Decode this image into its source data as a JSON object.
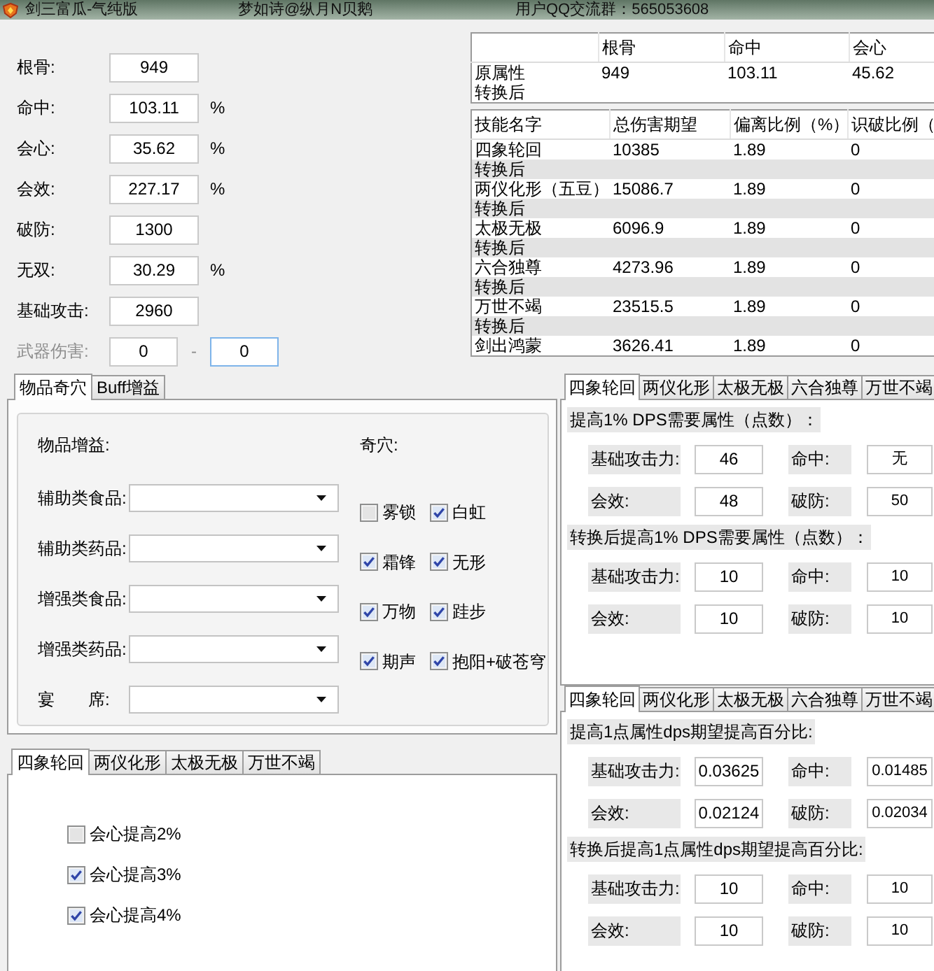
{
  "title_bar": {
    "app_title": "剑三富瓜-气纯版",
    "author": "梦如诗@纵月N贝鹅",
    "group_info": "用户QQ交流群：565053608"
  },
  "attributes": [
    {
      "label": "根骨:",
      "value": "949"
    },
    {
      "label": "命中:",
      "value": "103.11",
      "unit": "%"
    },
    {
      "label": "会心:",
      "value": "35.62",
      "unit": "%"
    },
    {
      "label": "会效:",
      "value": "227.17",
      "unit": "%"
    },
    {
      "label": "破防:",
      "value": "1300"
    },
    {
      "label": "无双:",
      "value": "30.29",
      "unit": "%"
    },
    {
      "label": "基础攻击:",
      "value": "2960"
    }
  ],
  "weapon_damage": {
    "label": "武器伤害:",
    "disabled": true,
    "separator": "-",
    "fields": [
      {
        "value": "0",
        "focused": false
      },
      {
        "value": "0",
        "focused": true
      }
    ]
  },
  "attribute_table": {
    "columns": [
      "根骨",
      "命中",
      "会心"
    ],
    "rows": [
      {
        "label": "原属性",
        "cells": [
          "949",
          "103.11",
          "45.62"
        ]
      },
      {
        "label": "转换后"
      }
    ]
  },
  "skill_table": {
    "columns": [
      "技能名字",
      "总伤害期望",
      "偏离比例（%）",
      "识破比例（"
    ],
    "rows": [
      {
        "kind": "skill",
        "cells": [
          "四象轮回",
          "10385",
          "1.89",
          "0"
        ]
      },
      {
        "kind": "converted",
        "cells": [
          "转换后"
        ]
      },
      {
        "kind": "skill",
        "cells": [
          "两仪化形（五豆）",
          "15086.7",
          "1.89",
          "0"
        ]
      },
      {
        "kind": "converted",
        "cells": [
          "转换后"
        ]
      },
      {
        "kind": "skill",
        "cells": [
          "太极无极",
          "6096.9",
          "1.89",
          "0"
        ]
      },
      {
        "kind": "converted",
        "cells": [
          "转换后"
        ]
      },
      {
        "kind": "skill",
        "cells": [
          "六合独尊",
          "4273.96",
          "1.89",
          "0"
        ]
      },
      {
        "kind": "converted",
        "cells": [
          "转换后"
        ]
      },
      {
        "kind": "skill",
        "cells": [
          "万世不竭",
          "23515.5",
          "1.89",
          "0"
        ]
      },
      {
        "kind": "converted",
        "cells": [
          "转换后"
        ]
      },
      {
        "kind": "skill",
        "cells": [
          "剑出鸿蒙",
          "3626.41",
          "1.89",
          "0"
        ]
      }
    ]
  },
  "item_panel": {
    "tabs": [
      {
        "label": "物品奇穴",
        "selected": true
      },
      {
        "label": "Buff增益",
        "selected": false
      }
    ],
    "items_heading": "物品增益:",
    "qixue_heading": "奇穴:",
    "dropdowns": [
      {
        "label": "辅助类食品:"
      },
      {
        "label": "辅助类药品:"
      },
      {
        "label": "增强类食品:"
      },
      {
        "label": "增强类药品:"
      },
      {
        "label": "宴　　席:"
      }
    ],
    "qixue": [
      {
        "label": "雾锁",
        "checked": false
      },
      {
        "label": "白虹",
        "checked": true
      },
      {
        "label": "霜锋",
        "checked": true
      },
      {
        "label": "无形",
        "checked": true
      },
      {
        "label": "万物",
        "checked": true
      },
      {
        "label": "跬步",
        "checked": true
      },
      {
        "label": "期声",
        "checked": true
      },
      {
        "label": "抱阳+破苍穹",
        "checked": true
      }
    ]
  },
  "dps_panels": [
    {
      "tabs": [
        {
          "label": "四象轮回",
          "selected": true
        },
        {
          "label": "两仪化形",
          "selected": false
        },
        {
          "label": "太极无极",
          "selected": false
        },
        {
          "label": "六合独尊",
          "selected": false
        },
        {
          "label": "万世不竭",
          "selected": false
        }
      ],
      "sections": [
        {
          "heading": "提高1% DPS需要属性（点数）：",
          "fields": [
            {
              "label": "基础攻击力:",
              "value": "46"
            },
            {
              "label": "命中:",
              "value": "无"
            },
            {
              "label": "会效:",
              "value": "48"
            },
            {
              "label": "破防:",
              "value": "50"
            }
          ]
        },
        {
          "heading": "转换后提高1% DPS需要属性（点数）：",
          "fields": [
            {
              "label": "基础攻击力:",
              "value": "10"
            },
            {
              "label": "命中:",
              "value": "10"
            },
            {
              "label": "会效:",
              "value": "10"
            },
            {
              "label": "破防:",
              "value": "10"
            }
          ]
        }
      ]
    },
    {
      "tabs": [
        {
          "label": "四象轮回",
          "selected": true
        },
        {
          "label": "两仪化形",
          "selected": false
        },
        {
          "label": "太极无极",
          "selected": false
        },
        {
          "label": "六合独尊",
          "selected": false
        },
        {
          "label": "万世不竭",
          "selected": false
        }
      ],
      "sections": [
        {
          "heading": "提高1点属性dps期望提高百分比:",
          "fields": [
            {
              "label": "基础攻击力:",
              "value": "0.03625"
            },
            {
              "label": "命中:",
              "value": "0.01485"
            },
            {
              "label": "会效:",
              "value": "0.02124"
            },
            {
              "label": "破防:",
              "value": "0.02034"
            }
          ]
        },
        {
          "heading": "转换后提高1点属性dps期望提高百分比:",
          "fields": [
            {
              "label": "基础攻击力:",
              "value": "10"
            },
            {
              "label": "命中:",
              "value": "10"
            },
            {
              "label": "会效:",
              "value": "10"
            },
            {
              "label": "破防:",
              "value": "10"
            }
          ]
        }
      ]
    }
  ],
  "bonus_panel": {
    "tabs": [
      {
        "label": "四象轮回",
        "selected": true
      },
      {
        "label": "两仪化形",
        "selected": false
      },
      {
        "label": "太极无极",
        "selected": false
      },
      {
        "label": "万世不竭",
        "selected": false
      }
    ],
    "options": [
      {
        "label": "会心提高2%",
        "checked": false
      },
      {
        "label": "会心提高3%",
        "checked": true
      },
      {
        "label": "会心提高4%",
        "checked": true
      }
    ]
  }
}
